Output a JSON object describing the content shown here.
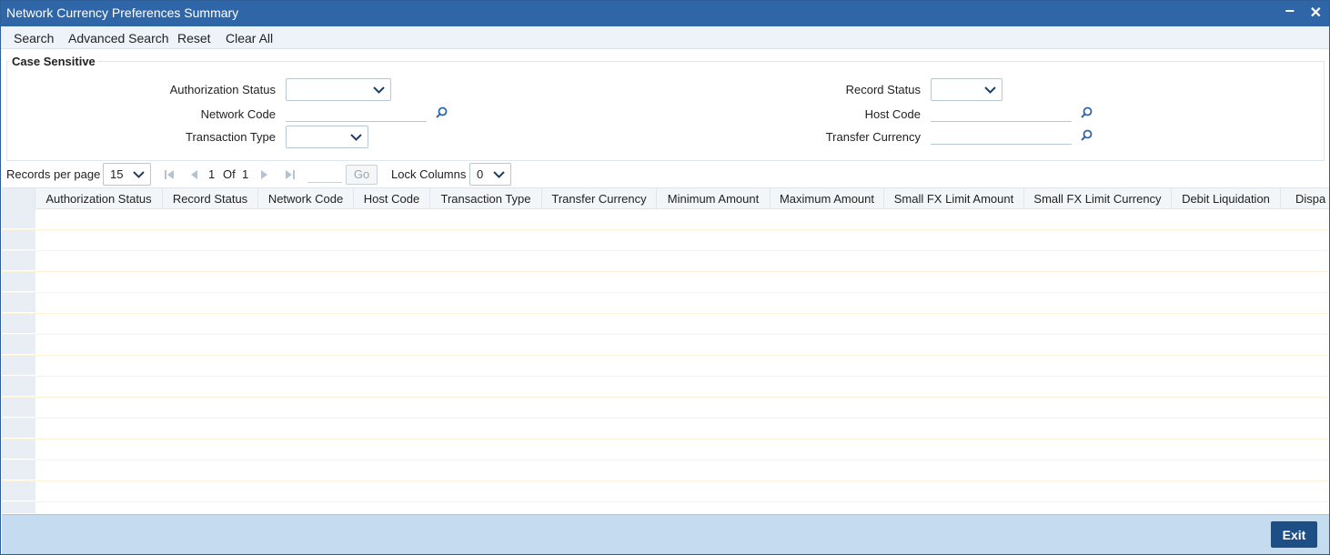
{
  "window": {
    "title": "Network Currency Preferences Summary",
    "minimize": "−",
    "close": "✕"
  },
  "toolbar": {
    "search": "Search",
    "advanced_search": "Advanced Search",
    "reset": "Reset",
    "clear_all": "Clear All"
  },
  "form": {
    "legend": "Case Sensitive",
    "authorization_status_label": "Authorization Status",
    "authorization_status_value": "",
    "network_code_label": "Network Code",
    "network_code_value": "",
    "transaction_type_label": "Transaction Type",
    "transaction_type_value": "",
    "record_status_label": "Record Status",
    "record_status_value": "",
    "host_code_label": "Host Code",
    "host_code_value": "",
    "transfer_currency_label": "Transfer Currency",
    "transfer_currency_value": ""
  },
  "pager": {
    "records_per_page_label": "Records per page",
    "records_per_page_value": "15",
    "current_page": "1",
    "of_label": "Of",
    "total_pages": "1",
    "go_label": "Go",
    "lock_columns_label": "Lock Columns",
    "lock_columns_value": "0"
  },
  "grid": {
    "columns": [
      "Authorization Status",
      "Record Status",
      "Network Code",
      "Host Code",
      "Transaction Type",
      "Transfer Currency",
      "Minimum Amount",
      "Maximum Amount",
      "Small FX Limit Amount",
      "Small FX Limit Currency",
      "Debit Liquidation",
      "Dispa"
    ],
    "rows": []
  },
  "footer": {
    "exit_label": "Exit"
  },
  "colors": {
    "title_bar": "#2f66a8",
    "footer": "#c5dbef",
    "exit_button": "#1d4f86"
  }
}
